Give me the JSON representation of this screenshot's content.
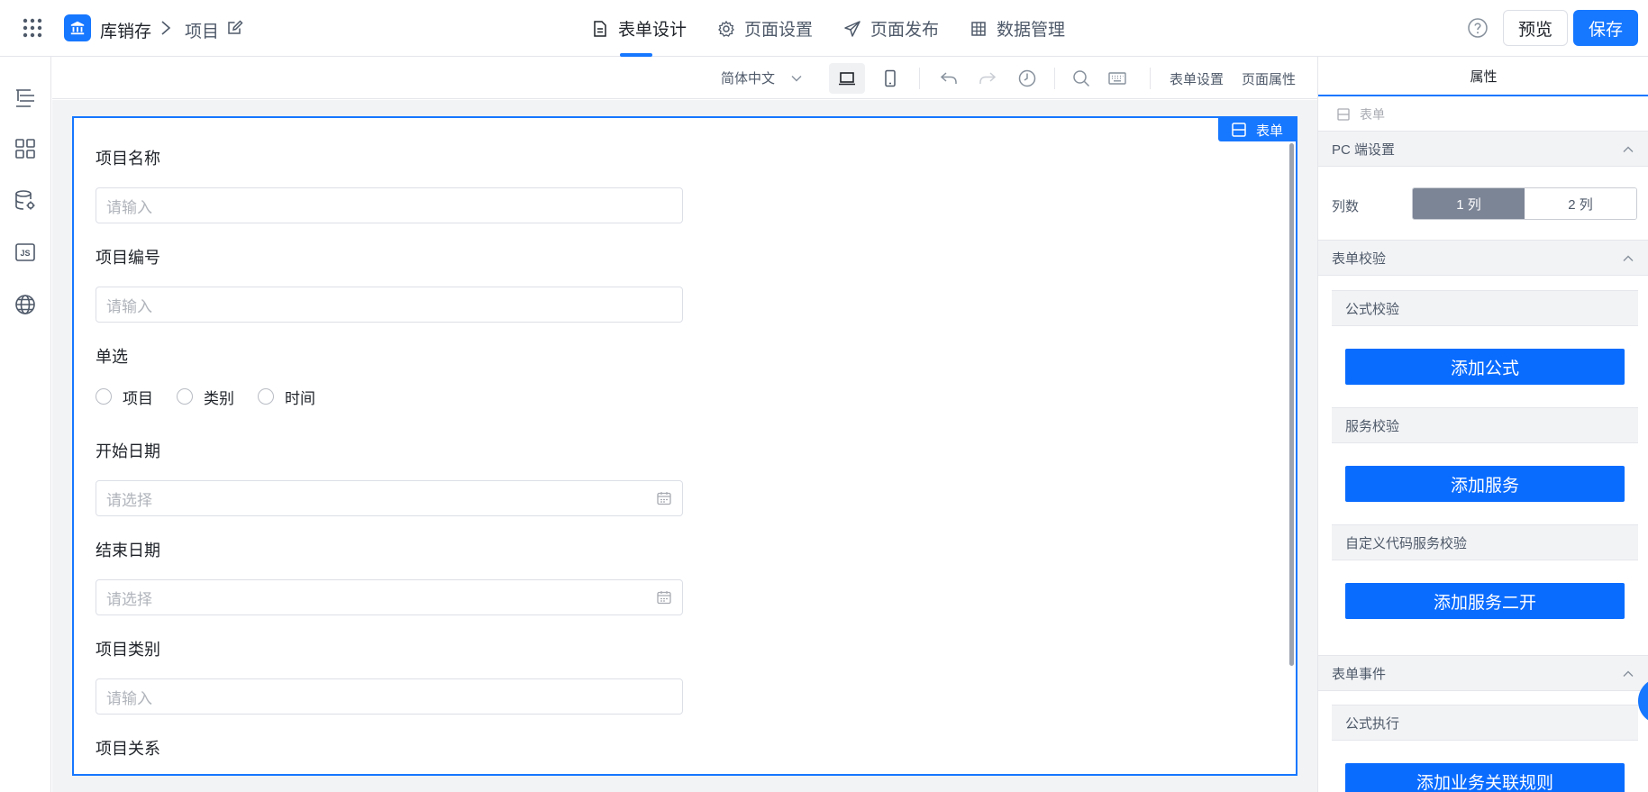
{
  "header": {
    "app_name": "库销存",
    "page_name": "项目",
    "tabs": [
      {
        "label": "表单设计",
        "icon": "document-icon",
        "active": true
      },
      {
        "label": "页面设置",
        "icon": "gear-icon",
        "active": false
      },
      {
        "label": "页面发布",
        "icon": "send-icon",
        "active": false
      },
      {
        "label": "数据管理",
        "icon": "table-icon",
        "active": false
      }
    ],
    "preview_label": "预览",
    "save_label": "保存",
    "accent_color": "#1677ff"
  },
  "left_rail": {
    "icons": [
      "outline-tree-icon",
      "components-grid-icon",
      "data-source-icon",
      "js-code-icon",
      "globe-icon"
    ]
  },
  "toolbar": {
    "language": "简体中文",
    "form_settings_label": "表单设置",
    "page_properties_label": "页面属性"
  },
  "form": {
    "tag_label": "表单",
    "fields": [
      {
        "label": "项目名称",
        "type": "input",
        "placeholder": "请输入"
      },
      {
        "label": "项目编号",
        "type": "input",
        "placeholder": "请输入"
      },
      {
        "label": "单选",
        "type": "radio",
        "options": [
          "项目",
          "类别",
          "时间"
        ]
      },
      {
        "label": "开始日期",
        "type": "date",
        "placeholder": "请选择"
      },
      {
        "label": "结束日期",
        "type": "date",
        "placeholder": "请选择"
      },
      {
        "label": "项目类别",
        "type": "input",
        "placeholder": "请输入"
      },
      {
        "label": "项目关系",
        "type": "input",
        "placeholder": ""
      }
    ]
  },
  "properties": {
    "tab_label": "属性",
    "crumb": "表单",
    "pc_section": "PC 端设置",
    "columns_label": "列数",
    "columns_options": [
      "1 列",
      "2 列"
    ],
    "columns_selected": "1 列",
    "validation_section": "表单校验",
    "formula_validation": "公式校验",
    "add_formula": "添加公式",
    "service_validation": "服务校验",
    "add_service": "添加服务",
    "custom_validation": "自定义代码服务校验",
    "add_service_dev": "添加服务二开",
    "events_section": "表单事件",
    "formula_execution": "公式执行",
    "add_rule": "添加业务关联规则"
  }
}
